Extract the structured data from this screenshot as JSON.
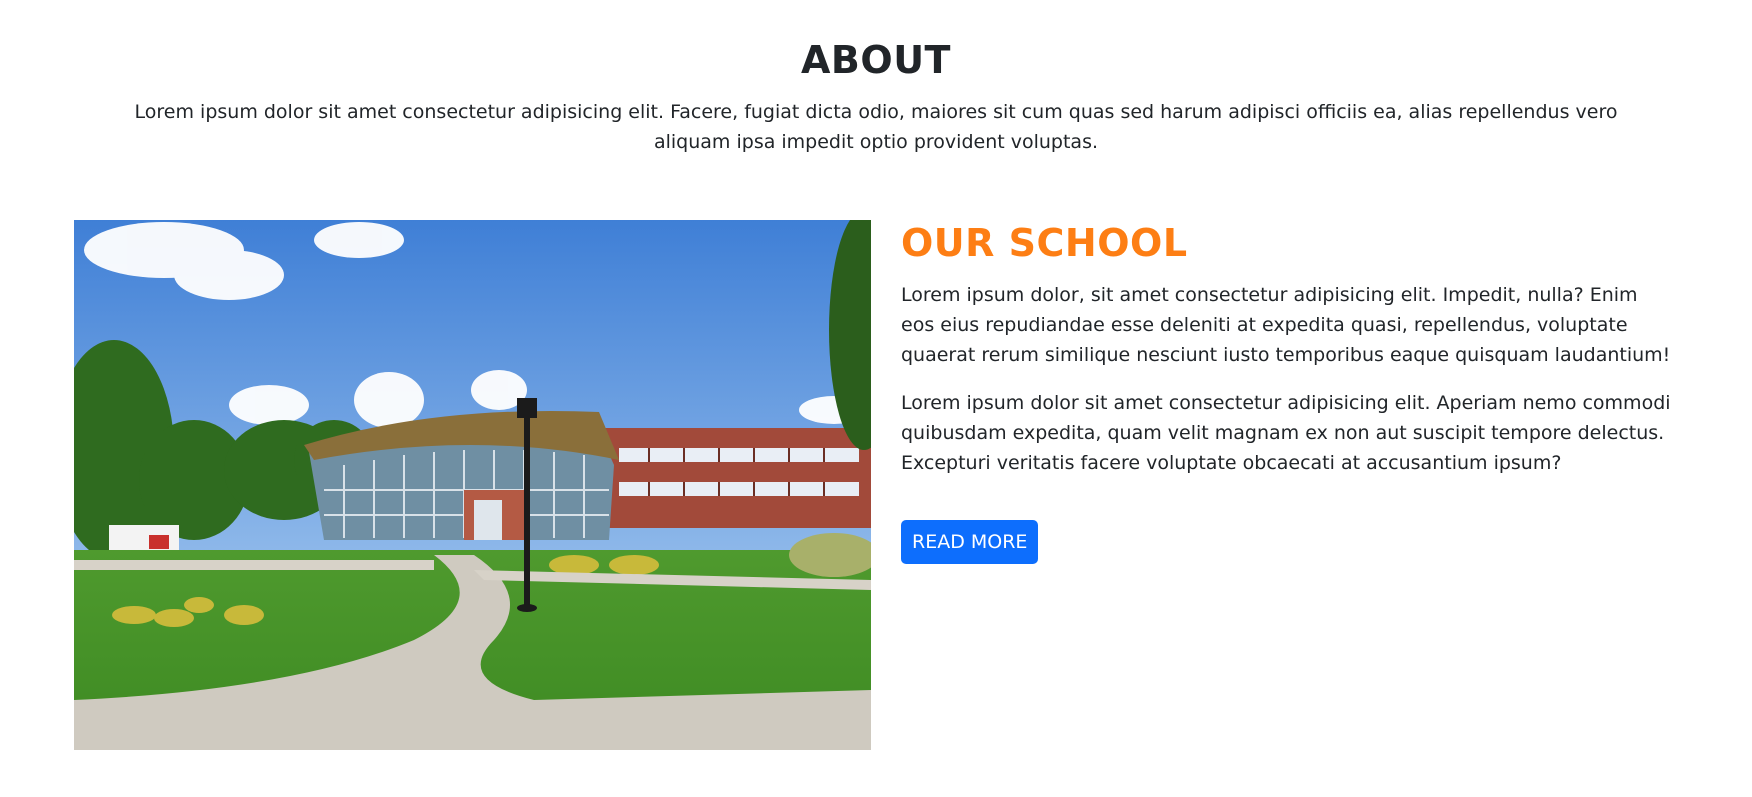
{
  "about": {
    "title": "ABOUT",
    "intro": "Lorem ipsum dolor sit amet consectetur adipisicing elit. Facere, fugiat dicta odio, maiores sit cum quas sed harum adipisci officiis ea, alias repellendus vero aliquam ipsa impedit optio provident voluptas."
  },
  "school": {
    "title": "OUR SCHOOL",
    "paragraph_1": "Lorem ipsum dolor, sit amet consectetur adipisicing elit. Impedit, nulla? Enim eos eius repudiandae esse deleniti at expedita quasi, repellendus, voluptate quaerat rerum similique nesciunt iusto temporibus eaque quisquam laudantium!",
    "paragraph_2": "Lorem ipsum dolor sit amet consectetur adipisicing elit. Aperiam nemo commodi quibusdam expedita, quam velit magnam ex non aut suscipit tempore delectus. Excepturi veritatis facere voluptate obcaecati at accusantium ipsum?",
    "button_label": "READ MORE"
  },
  "colors": {
    "accent_orange": "#fd7e14",
    "button_blue": "#0d6efd",
    "text_dark": "#212529"
  }
}
